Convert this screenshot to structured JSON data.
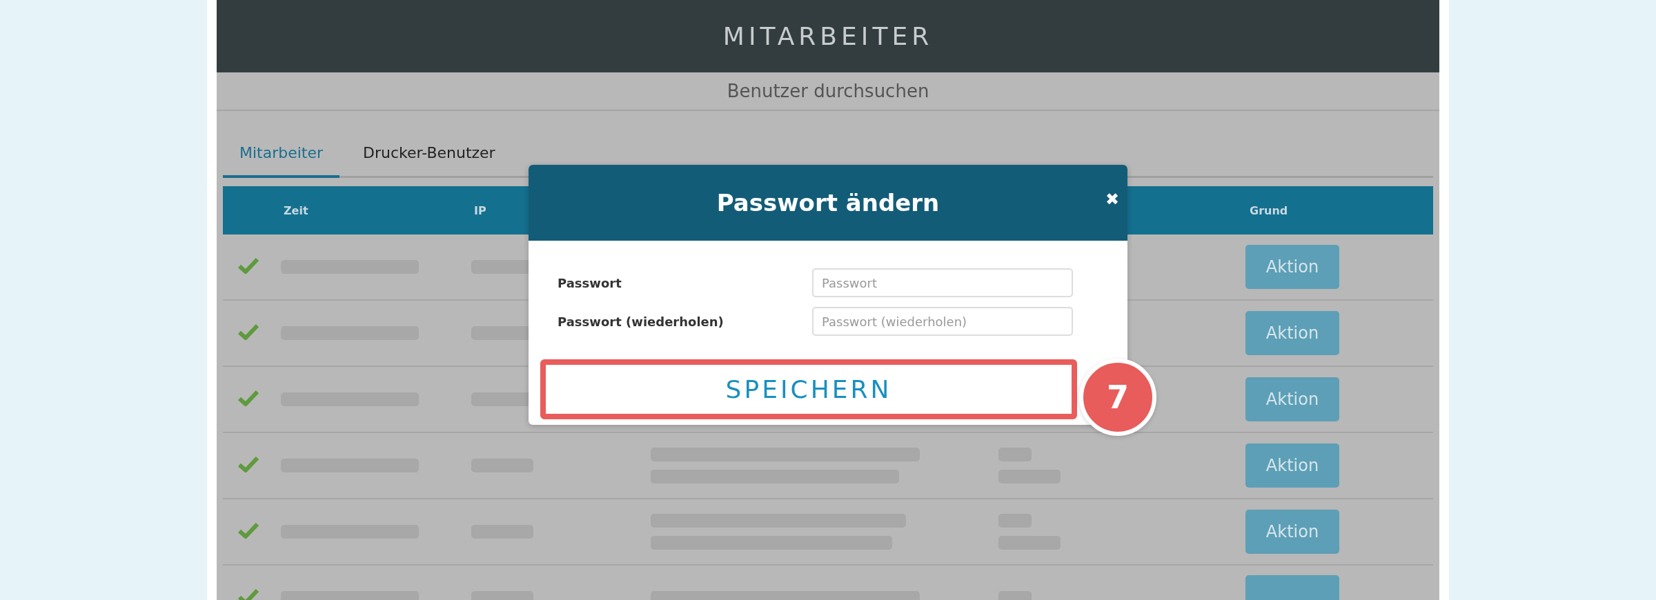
{
  "header": {
    "title": "MITARBEITER"
  },
  "subheader": {
    "title": "Benutzer durchsuchen"
  },
  "tabs": [
    {
      "label": "Mitarbeiter",
      "selected": true
    },
    {
      "label": "Drucker-Benutzer",
      "selected": false
    }
  ],
  "table": {
    "columns": [
      "Zeit",
      "IP",
      "Grund"
    ],
    "rows": [
      {
        "ok": true,
        "action": "Aktion"
      },
      {
        "ok": true,
        "action": "Aktion"
      },
      {
        "ok": true,
        "action": "Aktion"
      },
      {
        "ok": true,
        "action": "Aktion"
      },
      {
        "ok": true,
        "action": "Aktion"
      },
      {
        "ok": true
      }
    ]
  },
  "dialog": {
    "title": "Passwort ändern",
    "close": "✖",
    "fields": [
      {
        "label": "Passwort",
        "placeholder": "Passwort"
      },
      {
        "label": "Passwort (wiederholen)",
        "placeholder": "Passwort (wiederholen)"
      }
    ],
    "button": "SPEICHERN",
    "highlighted": true,
    "step": "7"
  }
}
